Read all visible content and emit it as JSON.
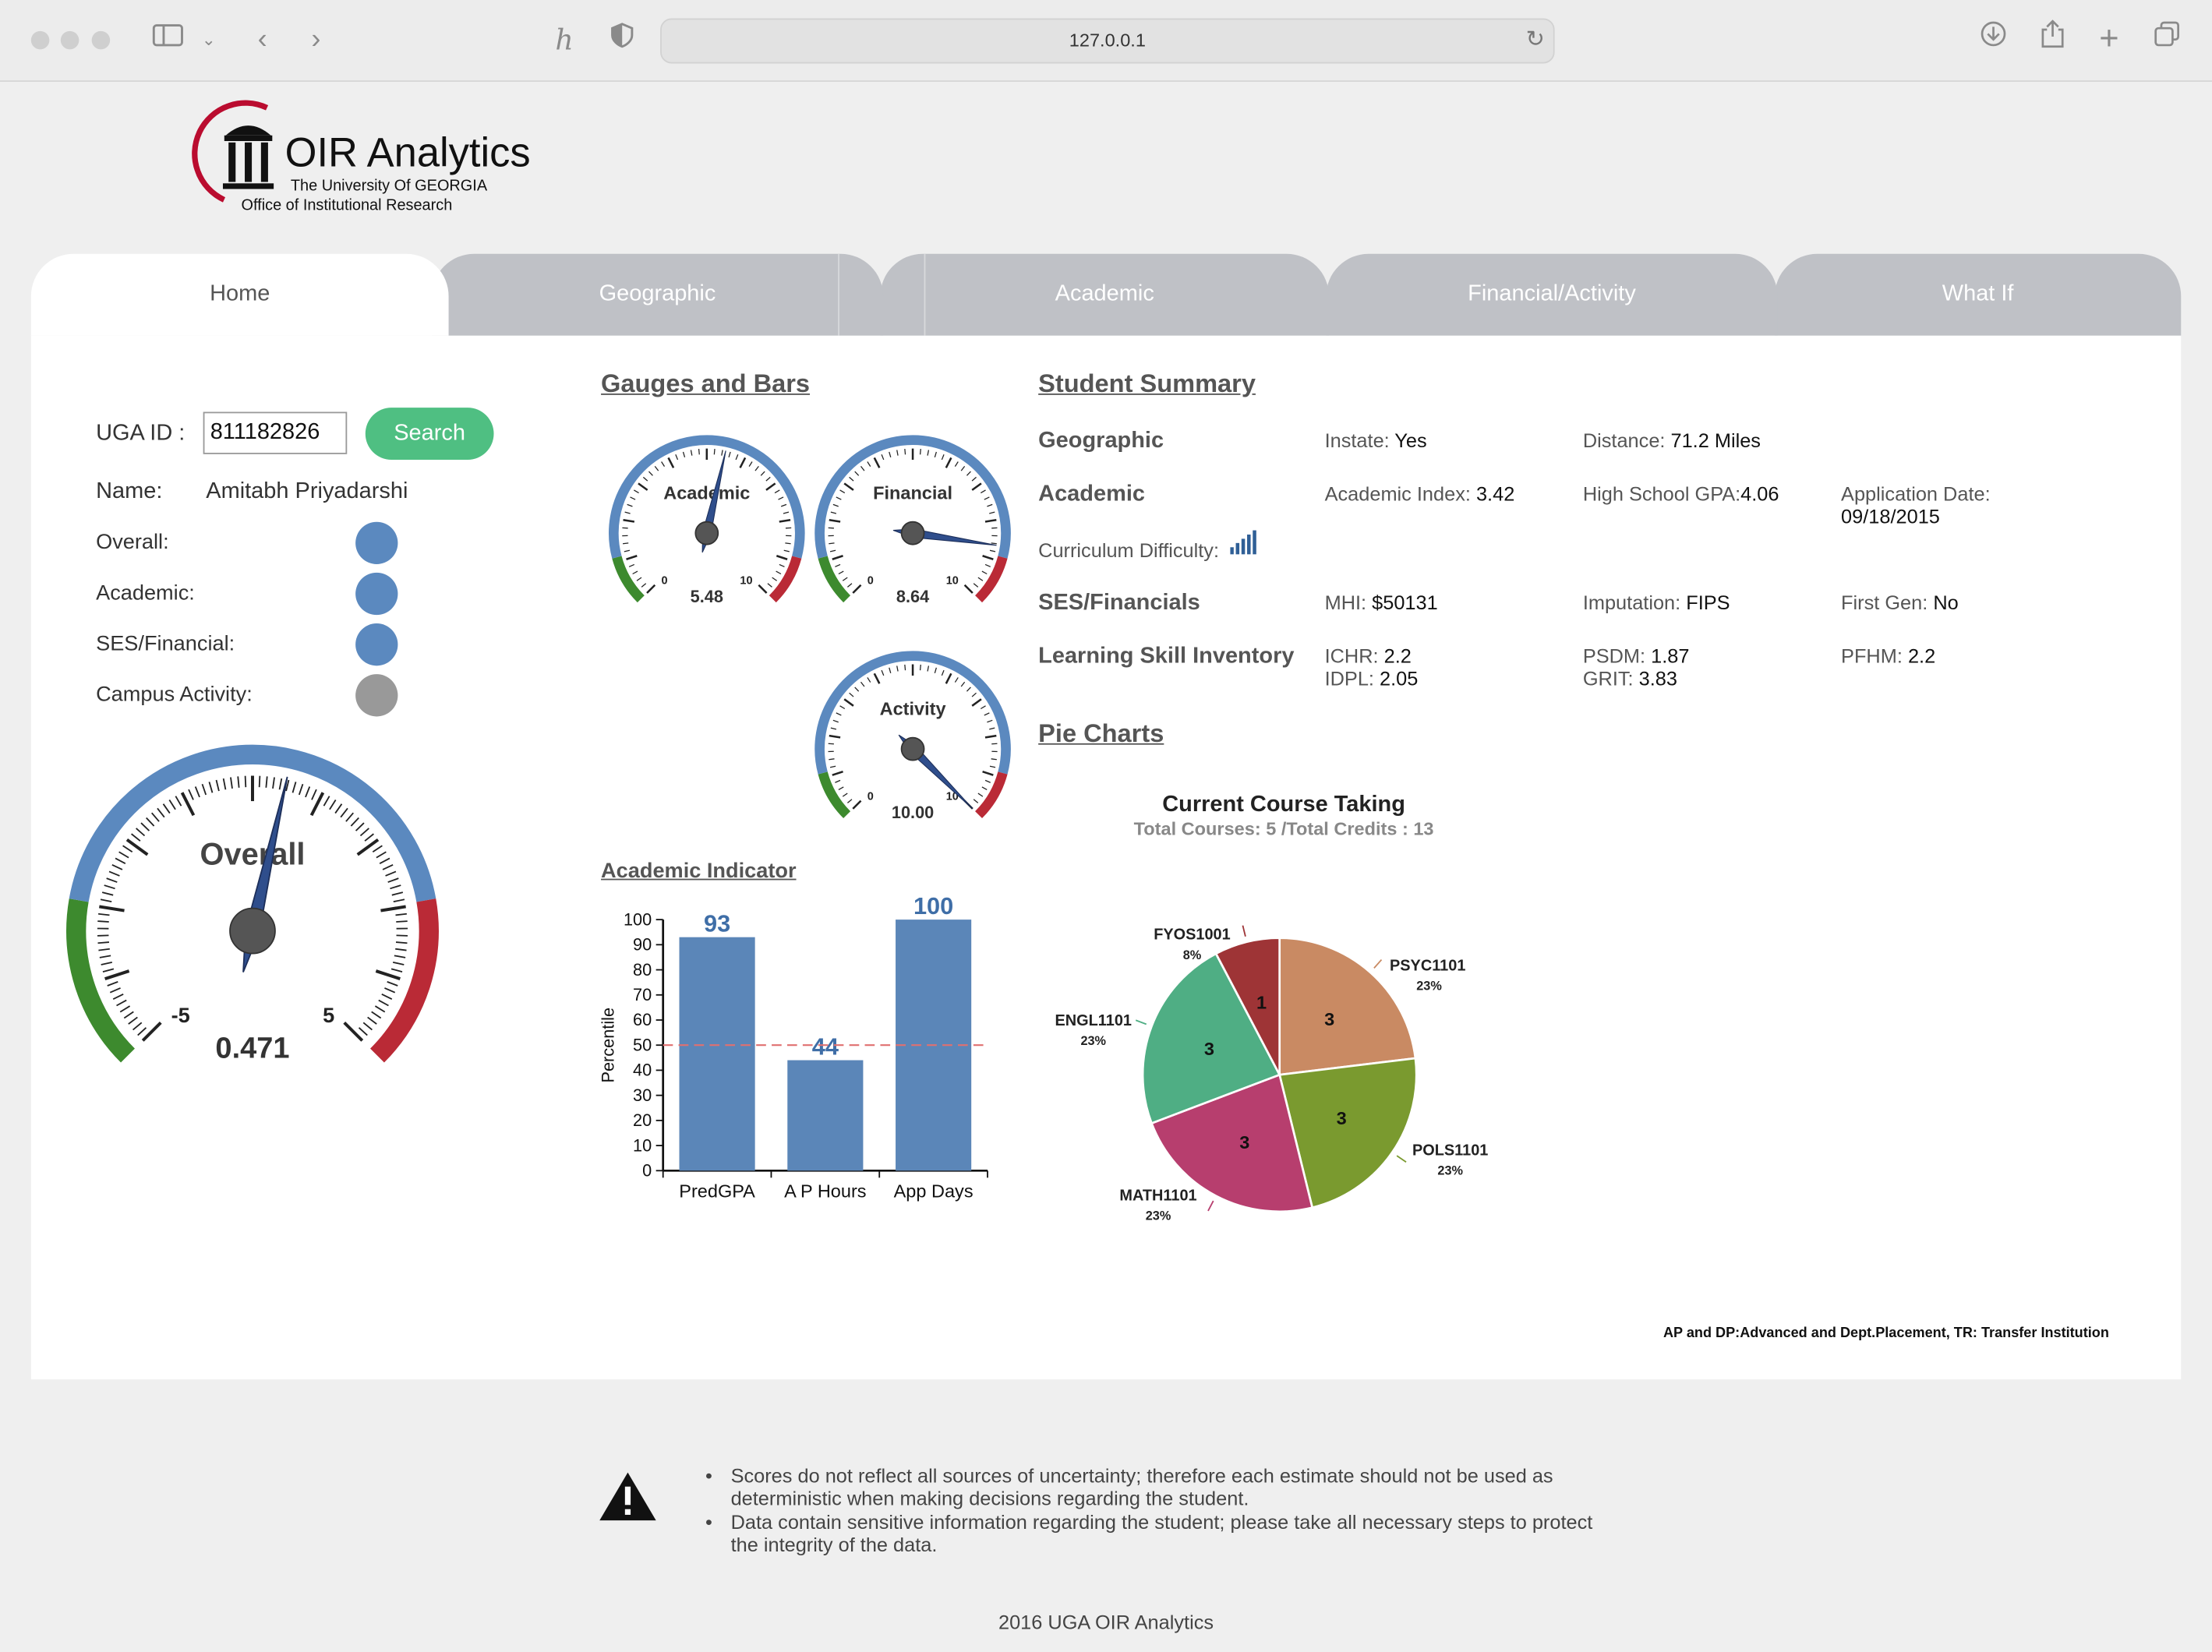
{
  "browser": {
    "url": "127.0.0.1"
  },
  "logo": {
    "title": "OIR Analytics",
    "line1": "The University Of GEORGIA",
    "line2": "Office of Institutional Research"
  },
  "tabs": [
    {
      "label": "Home",
      "active": true
    },
    {
      "label": "Geographic"
    },
    {
      "label": "Academic"
    },
    {
      "label": "Financial/Activity"
    },
    {
      "label": "What If"
    }
  ],
  "search": {
    "label": "UGA ID :",
    "value": "811182826",
    "button": "Search"
  },
  "student": {
    "name_label": "Name:",
    "name": "Amitabh Priyadarshi",
    "indicators": [
      {
        "label": "Overall:",
        "color": "#5b89bf"
      },
      {
        "label": "Academic:",
        "color": "#5b89bf"
      },
      {
        "label": "SES/Financial:",
        "color": "#5b89bf"
      },
      {
        "label": "Campus Activity:",
        "color": "#999999"
      }
    ]
  },
  "overall_gauge": {
    "title": "Overall",
    "value": "0.471",
    "min_label": "-5",
    "max_label": "5",
    "min": -5,
    "max": 5,
    "reading": 0.471
  },
  "gauges_section": {
    "title": "Gauges and Bars"
  },
  "small_gauges": [
    {
      "title": "Academic",
      "value": "5.48",
      "reading": 5.48,
      "min": "0",
      "max": "10"
    },
    {
      "title": "Financial",
      "value": "8.64",
      "reading": 8.64,
      "min": "0",
      "max": "10"
    },
    {
      "title": "Activity",
      "value": "10.00",
      "reading": 10.0,
      "min": "0",
      "max": "10"
    }
  ],
  "academic_indicator": {
    "title": "Academic Indicator",
    "chart_data": {
      "type": "bar",
      "categories": [
        "PredGPA",
        "A P Hours",
        "App Days"
      ],
      "values": [
        93,
        44,
        100
      ],
      "value_labels": [
        "93",
        "44",
        "100"
      ],
      "ylabel": "Percentile",
      "ylim": [
        0,
        100
      ],
      "yticks": [
        "0",
        "10",
        "20",
        "30",
        "40",
        "50",
        "60",
        "70",
        "80",
        "90",
        "100"
      ],
      "reference_line": 50,
      "bar_color": "#5b86b8"
    }
  },
  "summary": {
    "title": "Student Summary",
    "geographic": {
      "head": "Geographic",
      "instate_label": "Instate:",
      "instate": "Yes",
      "distance_label": "Distance:",
      "distance": "71.2 Miles"
    },
    "academic": {
      "head": "Academic",
      "index_label": "Academic Index:",
      "index": "3.42",
      "hsgpa_label": "High School GPA:",
      "hsgpa": "4.06",
      "appdate_label": "Application Date:",
      "appdate": "09/18/2015",
      "curr_label": "Curriculum Difficulty:"
    },
    "ses": {
      "head": "SES/Financials",
      "mhi_label": "MHI:",
      "mhi": "$50131",
      "imp_label": "Imputation:",
      "imp": "FIPS",
      "fg_label": "First Gen:",
      "fg": "No"
    },
    "lsi": {
      "head": "Learning Skill Inventory",
      "ichr_label": "ICHR:",
      "ichr": "2.2",
      "idpl_label": "IDPL:",
      "idpl": "2.05",
      "psdm_label": "PSDM:",
      "psdm": "1.87",
      "grit_label": "GRIT:",
      "grit": "3.83",
      "pfhm_label": "PFHM:",
      "pfhm": "2.2"
    }
  },
  "pie_section": {
    "title": "Pie Charts"
  },
  "pie": {
    "chart_data": {
      "type": "pie",
      "title": "Current Course Taking",
      "subtitle": "Total Courses: 5 /Total Credits : 13",
      "slices": [
        {
          "label": "PSYC1101",
          "value": 3,
          "value_label": "3",
          "pct": "23%",
          "color": "#c98a63"
        },
        {
          "label": "POLS1101",
          "value": 3,
          "value_label": "3",
          "pct": "23%",
          "color": "#7a9a2f"
        },
        {
          "label": "MATH1101",
          "value": 3,
          "value_label": "3",
          "pct": "23%",
          "color": "#b73e6e"
        },
        {
          "label": "ENGL1101",
          "value": 3,
          "value_label": "3",
          "pct": "23%",
          "color": "#4fae84"
        },
        {
          "label": "FYOS1001",
          "value": 1,
          "value_label": "1",
          "pct": "8%",
          "color": "#9e3436"
        }
      ]
    }
  },
  "footnote": "AP and DP:Advanced and Dept.Placement, TR: Transfer Institution",
  "disclaimer": [
    "Scores do not reflect all sources of uncertainty; therefore each estimate should not be used as deterministic when making decisions regarding the student.",
    "Data contain sensitive information regarding the student; please take all necessary steps to protect the integrity of the data."
  ],
  "copyright": "2016 UGA OIR Analytics"
}
